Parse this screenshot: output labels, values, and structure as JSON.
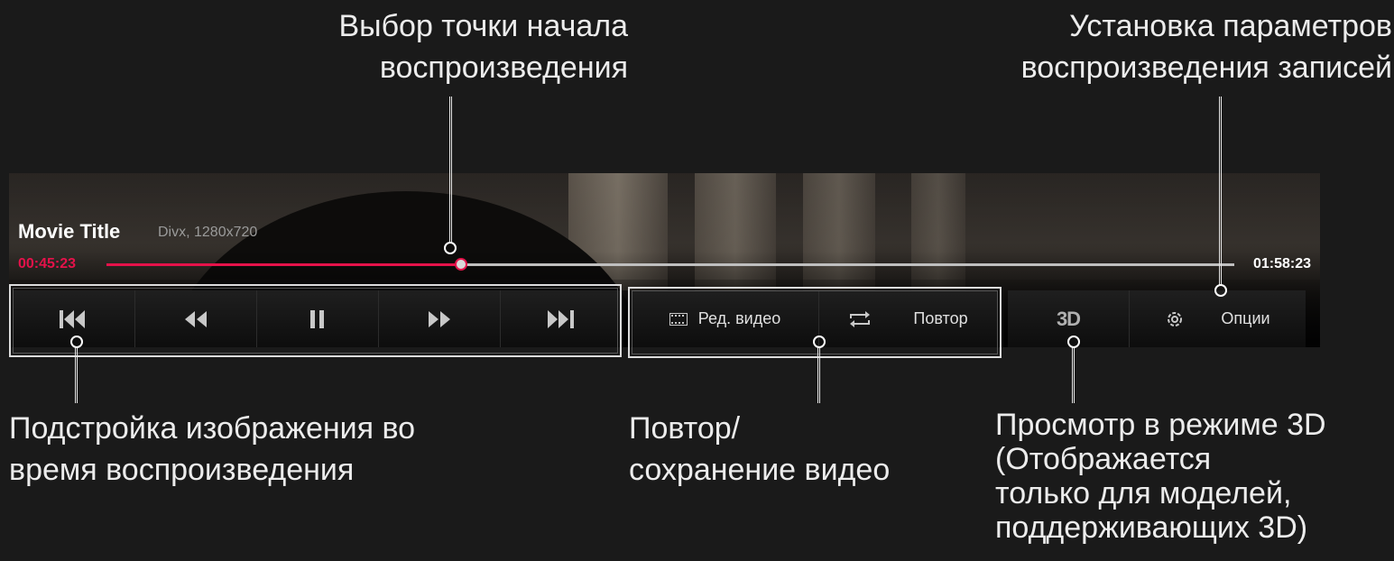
{
  "callouts": {
    "seek": [
      "Выбор точки начала",
      "воспроизведения"
    ],
    "settings": [
      "Установка параметров",
      "воспроизведения записей"
    ],
    "picture": [
      "Подстройка изображения во",
      "время воспроизведения"
    ],
    "repeat": [
      "Повтор/",
      "сохранение видео"
    ],
    "threed": [
      "Просмотр в режиме 3D",
      "(Отображается",
      "только для моделей,",
      "поддерживающих 3D)"
    ]
  },
  "player": {
    "title": "Movie Title",
    "meta": "Divx, 1280x720",
    "current_time": "00:45:23",
    "total_time": "01:58:23",
    "progress": 0.314,
    "buttons": {
      "edit_video": "Ред. видео",
      "repeat": "Повтор",
      "threed": "3D",
      "options": "Опции"
    },
    "icons": [
      "previous-icon",
      "rewind-icon",
      "pause-icon",
      "fast-forward-icon",
      "next-icon",
      "film-icon",
      "repeat-icon",
      "3d-icon",
      "gear-icon"
    ]
  },
  "colors": {
    "accent": "#e5124a",
    "background": "#1a1a1a"
  }
}
